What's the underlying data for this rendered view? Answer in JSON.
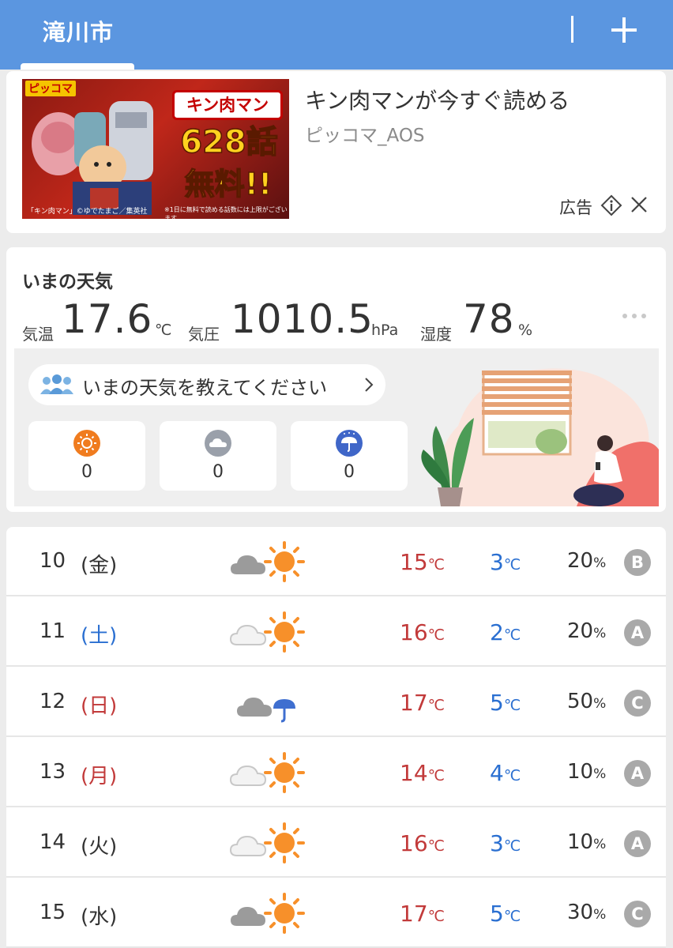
{
  "header": {
    "city": "滝川市"
  },
  "ad": {
    "title": "キン肉マンが今すぐ読める",
    "sponsor": "ピッコマ_AOS",
    "label": "広告",
    "image": {
      "badge": "ピッコマ",
      "title": "キン肉マン",
      "episodes": "628話",
      "free": "無料!!",
      "credit": "「キン肉マン」©ゆでたまご／集英社",
      "note": "※1日に無料で読める話数には上限がございます。"
    }
  },
  "now": {
    "title": "いまの天気",
    "temp": {
      "label": "気温",
      "value": "17.6",
      "unit": "℃"
    },
    "pressure": {
      "label": "気圧",
      "value": "1010.5",
      "unit": "hPa"
    },
    "humidity": {
      "label": "湿度",
      "value": "78",
      "unit": "%"
    },
    "report": {
      "prompt": "いまの天気を教えてください",
      "votes": [
        {
          "icon": "sun-icon",
          "count": "0",
          "color": "#f07c1f"
        },
        {
          "icon": "cloud-icon",
          "count": "0",
          "color": "#9aa0aa"
        },
        {
          "icon": "umbrella-icon",
          "count": "0",
          "color": "#3f66c8"
        }
      ]
    }
  },
  "forecast": [
    {
      "day": "10",
      "dow": "(金)",
      "icon": "cloud-sun-icon",
      "high": "15",
      "low": "3",
      "pop": "20",
      "rank": "B"
    },
    {
      "day": "11",
      "dow": "(土)",
      "icon": "cloud-sun-icon",
      "high": "16",
      "low": "2",
      "pop": "20",
      "rank": "A"
    },
    {
      "day": "12",
      "dow": "(日)",
      "icon": "cloud-umbrella-icon",
      "high": "17",
      "low": "5",
      "pop": "50",
      "rank": "C"
    },
    {
      "day": "13",
      "dow": "(月)",
      "icon": "cloud-sun-icon",
      "high": "14",
      "low": "4",
      "pop": "10",
      "rank": "A"
    },
    {
      "day": "14",
      "dow": "(火)",
      "icon": "cloud-sun-icon",
      "high": "16",
      "low": "3",
      "pop": "10",
      "rank": "A"
    },
    {
      "day": "15",
      "dow": "(水)",
      "icon": "cloud-sun-icon",
      "high": "17",
      "low": "5",
      "pop": "30",
      "rank": "C"
    }
  ],
  "units": {
    "celsius": "℃",
    "percent": "%"
  },
  "colors": {
    "header": "#5b96e0",
    "high": "#c23a3a",
    "low": "#2a6fd1",
    "rank": "#a9a9a9",
    "sun": "#f7902a"
  }
}
